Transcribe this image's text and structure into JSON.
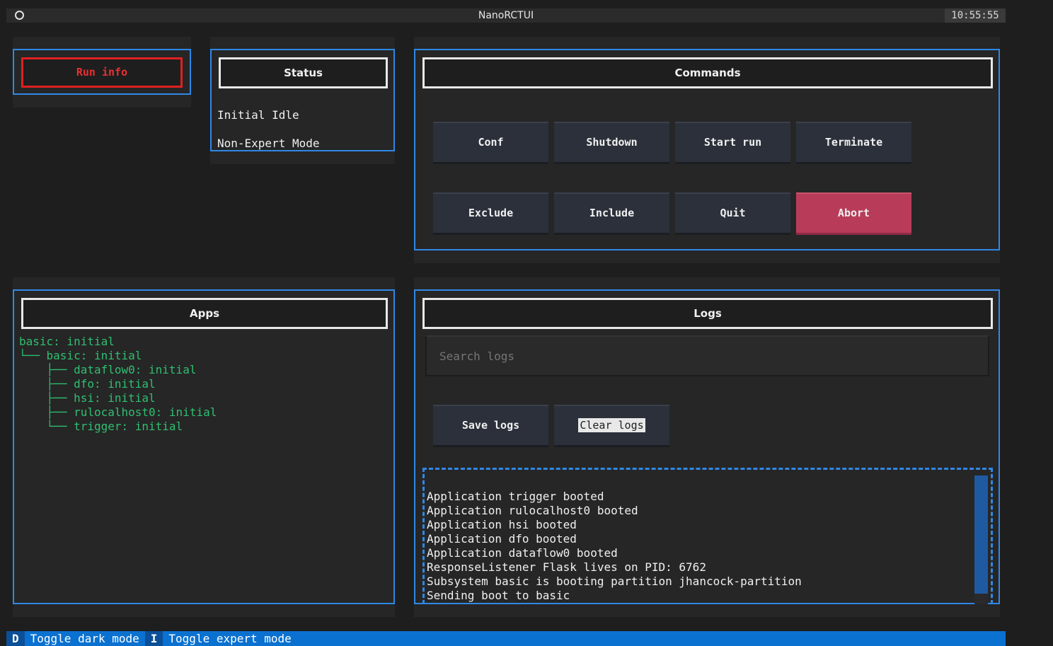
{
  "header": {
    "title": "NanoRCTUI",
    "clock": "10:55:55"
  },
  "run_info": {
    "label": "Run info"
  },
  "status": {
    "title": "Status",
    "state": "Initial Idle",
    "mode": "Non-Expert Mode"
  },
  "commands": {
    "title": "Commands",
    "buttons": [
      "Conf",
      "Shutdown",
      "Start run",
      "Terminate",
      "Exclude",
      "Include",
      "Quit",
      "Abort"
    ]
  },
  "apps": {
    "title": "Apps",
    "tree": [
      "basic: initial",
      "└── basic: initial",
      "    ├── dataflow0: initial",
      "    ├── dfo: initial",
      "    ├── hsi: initial",
      "    ├── rulocalhost0: initial",
      "    └── trigger: initial"
    ]
  },
  "logs": {
    "title": "Logs",
    "search_placeholder": "Search logs",
    "save_label": "Save logs",
    "clear_label": "Clear logs",
    "lines": [
      "Application trigger booted",
      "Application rulocalhost0 booted",
      "Application hsi booted",
      "Application dfo booted",
      "Application dataflow0 booted",
      "ResponseListener Flask lives on PID: 6762",
      "Subsystem basic is booting partition jhancock-partition",
      "Sending boot to basic"
    ]
  },
  "footer": {
    "bindings": [
      {
        "key": "D",
        "label": "Toggle dark mode"
      },
      {
        "key": "I",
        "label": "Toggle expert mode"
      }
    ]
  },
  "colors": {
    "accent": "#2f88e6",
    "tree_green": "#2fbf71",
    "abort": "#b83c5a",
    "run_info_red": "#e02020",
    "footer_bar": "#0a71d0"
  }
}
